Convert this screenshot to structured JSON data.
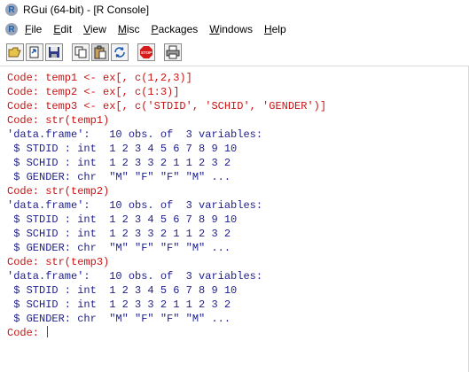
{
  "window": {
    "title": "RGui (64-bit) - [R Console]",
    "logo_text": "R"
  },
  "menu": {
    "icon_text": "R",
    "items": [
      "File",
      "Edit",
      "View",
      "Misc",
      "Packages",
      "Windows",
      "Help"
    ]
  },
  "toolbar": {
    "buttons": [
      {
        "icon": "open-script-icon"
      },
      {
        "icon": "load-workspace-icon"
      },
      {
        "icon": "save-icon"
      },
      {
        "icon": "copy-icon"
      },
      {
        "icon": "paste-icon"
      },
      {
        "icon": "copy-paste-icon"
      },
      {
        "icon": "stop-icon",
        "label": "STOP"
      },
      {
        "icon": "print-icon"
      }
    ]
  },
  "colors": {
    "code": "#c81414",
    "output": "#1e1e8c"
  },
  "console": {
    "lines": [
      {
        "type": "code",
        "text": "Code: temp1 <- ex[, c(1,2,3)]"
      },
      {
        "type": "code",
        "text": "Code: temp2 <- ex[, c(1:3)]"
      },
      {
        "type": "code",
        "text": "Code: temp3 <- ex[, c('STDID', 'SCHID', 'GENDER')]"
      },
      {
        "type": "code",
        "text": "Code: str(temp1)"
      },
      {
        "type": "out",
        "text": "'data.frame':   10 obs. of  3 variables:"
      },
      {
        "type": "out",
        "text": " $ STDID : int  1 2 3 4 5 6 7 8 9 10"
      },
      {
        "type": "out",
        "text": " $ SCHID : int  1 2 3 3 2 1 1 2 3 2"
      },
      {
        "type": "out",
        "text": " $ GENDER: chr  \"M\" \"F\" \"F\" \"M\" ..."
      },
      {
        "type": "code",
        "text": "Code: str(temp2)"
      },
      {
        "type": "out",
        "text": "'data.frame':   10 obs. of  3 variables:"
      },
      {
        "type": "out",
        "text": " $ STDID : int  1 2 3 4 5 6 7 8 9 10"
      },
      {
        "type": "out",
        "text": " $ SCHID : int  1 2 3 3 2 1 1 2 3 2"
      },
      {
        "type": "out",
        "text": " $ GENDER: chr  \"M\" \"F\" \"F\" \"M\" ..."
      },
      {
        "type": "code",
        "text": "Code: str(temp3)"
      },
      {
        "type": "out",
        "text": "'data.frame':   10 obs. of  3 variables:"
      },
      {
        "type": "out",
        "text": " $ STDID : int  1 2 3 4 5 6 7 8 9 10"
      },
      {
        "type": "out",
        "text": " $ SCHID : int  1 2 3 3 2 1 1 2 3 2"
      },
      {
        "type": "out",
        "text": " $ GENDER: chr  \"M\" \"F\" \"F\" \"M\" ..."
      }
    ],
    "prompt": "Code: "
  }
}
